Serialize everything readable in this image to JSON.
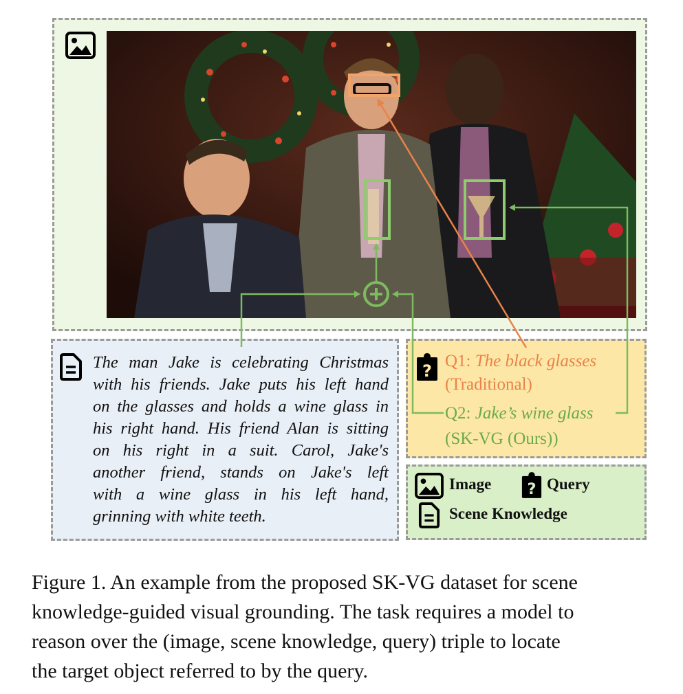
{
  "figure": {
    "knowledge_lines": [
      "The man Jake is celebrating Christmas",
      "with his friends. Jake puts his left hand",
      "on the glasses and holds a wine glass in",
      "his right hand. His friend Alan is sitting",
      "on his right in a suit. Carol, Jake's",
      "another friend, stands on Jake's left",
      "with a wine glass in his left hand,",
      "grinning with white teeth."
    ],
    "query1": {
      "prefix": "Q1: ",
      "text": "The black glasses",
      "method": "(Traditional)"
    },
    "query2": {
      "prefix": "Q2: ",
      "text": "Jake’s wine glass",
      "method": "(SK-VG (Ours))"
    },
    "legend": {
      "image": "Image",
      "query": "Query",
      "knowledge": "Scene Knowledge"
    },
    "icons": [
      "image-icon",
      "document-icon",
      "question-clipboard-icon",
      "plus-circle-icon"
    ],
    "colors": {
      "orange": "#e8834a",
      "green": "#7dbb5e",
      "image_panel": "#eef7e4",
      "knowledge_panel": "#e9eff7",
      "query_panel": "#fde7a6",
      "legend_panel": "#d9efc8"
    }
  },
  "caption": {
    "lines": [
      "Figure 1. An example from the proposed SK-VG dataset for scene",
      "knowledge-guided visual grounding. The task requires a model to",
      "reason over the (image, scene knowledge, query) triple to locate",
      "the target object referred to by the query."
    ]
  }
}
